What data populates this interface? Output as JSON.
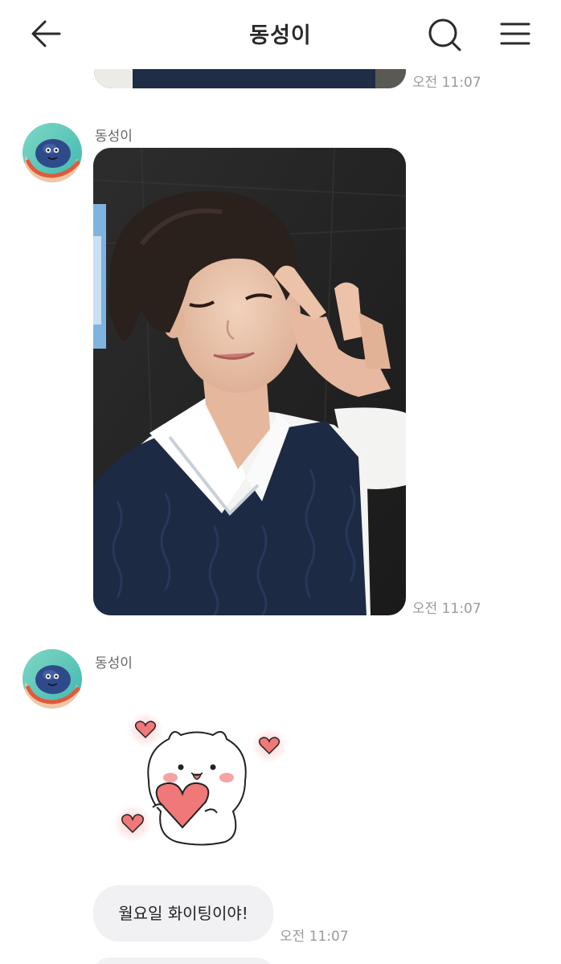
{
  "header": {
    "title": "동성이",
    "back_icon": "arrow-left-icon",
    "search_icon": "search-icon",
    "menu_icon": "hamburger-menu-icon"
  },
  "messages": [
    {
      "time": "오전 11:07"
    },
    {
      "sender": "동성이",
      "type": "photo",
      "time": "오전 11:07"
    },
    {
      "sender": "동성이",
      "type": "sticker",
      "time": ""
    },
    {
      "type": "text",
      "text": "월요일 화이팅이야!",
      "time": "오전 11:07"
    }
  ],
  "colors": {
    "bubble": "#f1f1f3",
    "heart": "#f07878",
    "sweater": "#1c2a44"
  }
}
